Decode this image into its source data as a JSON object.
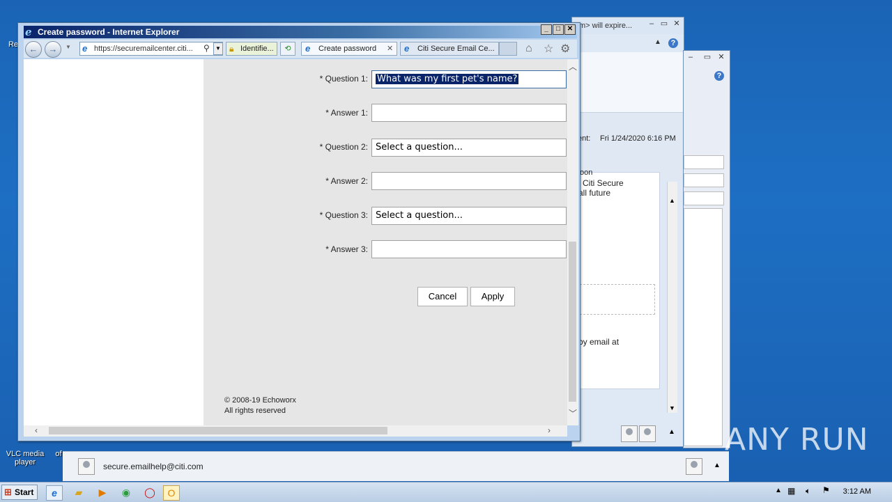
{
  "desktop": {
    "icons": [
      {
        "label": "Re"
      },
      {
        "label": "VLC media player"
      },
      {
        "label": "of"
      }
    ]
  },
  "outlook": {
    "title_fragment": "m> will expire...",
    "sent_label": "ent:",
    "sent_value": "Fri 1/24/2020 6:16 PM",
    "text_soon": "oon",
    "text_citi": "l Citi Secure",
    "text_future": "all future",
    "text_email": "by email at",
    "sender_email": "secure.emailhelp@citi.com"
  },
  "ie": {
    "window_title": "Create password - Internet Explorer",
    "address": "https://securemailcenter.citi...",
    "identified": "Identifie...",
    "tabs": [
      {
        "label": "Create password"
      },
      {
        "label": "Citi Secure Email Ce..."
      }
    ]
  },
  "form": {
    "fields": [
      {
        "label": "* Question 1:",
        "value": "What was my first pet's name?"
      },
      {
        "label": "* Answer 1:",
        "value": ""
      },
      {
        "label": "* Question 2:",
        "value": "Select a question..."
      },
      {
        "label": "* Answer 2:",
        "value": ""
      },
      {
        "label": "* Question 3:",
        "value": "Select a question..."
      },
      {
        "label": "* Answer 3:",
        "value": ""
      }
    ],
    "cancel_label": "Cancel",
    "apply_label": "Apply",
    "copyright": "© 2008-19 Echoworx",
    "rights": "All rights reserved"
  },
  "taskbar": {
    "start_label": "Start",
    "clock": "3:12 AM"
  },
  "watermark": "ANY RUN"
}
